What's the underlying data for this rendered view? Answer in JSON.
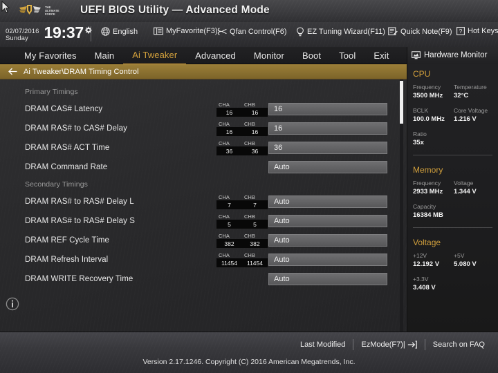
{
  "header": {
    "title": "UEFI BIOS Utility — Advanced Mode",
    "logo_line1": "THE",
    "logo_line2": "ULTIMATE",
    "logo_line3": "FORCE"
  },
  "toolbar": {
    "date": "02/07/2016",
    "day": "Sunday",
    "time": "19:37",
    "items": [
      {
        "label": "English",
        "icon": "globe-icon"
      },
      {
        "label": "MyFavorite(F3)",
        "icon": "book-icon"
      },
      {
        "label": "Qfan Control(F6)",
        "icon": "fan-icon"
      },
      {
        "label": "EZ Tuning Wizard(F11)",
        "icon": "bulb-icon"
      },
      {
        "label": "Quick Note(F9)",
        "icon": "note-icon"
      },
      {
        "label": "Hot Keys",
        "icon": "question-box-icon"
      }
    ]
  },
  "tabs": [
    {
      "label": "My Favorites",
      "active": false
    },
    {
      "label": "Main",
      "active": false
    },
    {
      "label": "Ai Tweaker",
      "active": true
    },
    {
      "label": "Advanced",
      "active": false
    },
    {
      "label": "Monitor",
      "active": false
    },
    {
      "label": "Boot",
      "active": false
    },
    {
      "label": "Tool",
      "active": false
    },
    {
      "label": "Exit",
      "active": false
    }
  ],
  "breadcrumb": {
    "path": "Ai Tweaker\\DRAM Timing Control"
  },
  "settings": [
    {
      "type": "section",
      "label": "Primary Timings"
    },
    {
      "type": "item",
      "label": "DRAM CAS# Latency",
      "cha": "16",
      "chb": "16",
      "value": "16"
    },
    {
      "type": "item",
      "label": "DRAM RAS# to CAS# Delay",
      "cha": "16",
      "chb": "16",
      "value": "16"
    },
    {
      "type": "item",
      "label": "DRAM RAS# ACT Time",
      "cha": "36",
      "chb": "36",
      "value": "36"
    },
    {
      "type": "item",
      "label": "DRAM Command Rate",
      "cha": "",
      "chb": "",
      "value": "Auto"
    },
    {
      "type": "section",
      "label": "Secondary Timings"
    },
    {
      "type": "item",
      "label": "DRAM RAS# to RAS# Delay L",
      "cha": "7",
      "chb": "7",
      "value": "Auto"
    },
    {
      "type": "item",
      "label": "DRAM RAS# to RAS# Delay S",
      "cha": "5",
      "chb": "5",
      "value": "Auto"
    },
    {
      "type": "item",
      "label": "DRAM REF Cycle Time",
      "cha": "382",
      "chb": "382",
      "value": "Auto"
    },
    {
      "type": "item",
      "label": "DRAM Refresh Interval",
      "cha": "11454",
      "chb": "11454",
      "value": "Auto"
    },
    {
      "type": "item",
      "label": "DRAM WRITE Recovery Time",
      "cha": "",
      "chb": "",
      "value": "Auto"
    }
  ],
  "channel_labels": {
    "cha": "CHA",
    "chb": "CHB"
  },
  "hardware_monitor": {
    "title": "Hardware Monitor",
    "sections": [
      {
        "title": "CPU",
        "fields": [
          {
            "key": "Frequency",
            "value": "3500 MHz",
            "full": false
          },
          {
            "key": "Temperature",
            "value": "32°C",
            "full": false
          },
          {
            "key": "BCLK",
            "value": "100.0 MHz",
            "full": false
          },
          {
            "key": "Core Voltage",
            "value": "1.216 V",
            "full": false
          },
          {
            "key": "Ratio",
            "value": "35x",
            "full": true
          }
        ]
      },
      {
        "title": "Memory",
        "fields": [
          {
            "key": "Frequency",
            "value": "2933 MHz",
            "full": false
          },
          {
            "key": "Voltage",
            "value": "1.344 V",
            "full": false
          },
          {
            "key": "Capacity",
            "value": "16384 MB",
            "full": true
          }
        ]
      },
      {
        "title": "Voltage",
        "fields": [
          {
            "key": "+12V",
            "value": "12.192 V",
            "full": false
          },
          {
            "key": "+5V",
            "value": "5.080 V",
            "full": false
          },
          {
            "key": "+3.3V",
            "value": "3.408 V",
            "full": true
          }
        ]
      }
    ]
  },
  "footer": {
    "buttons": [
      {
        "label": "Last Modified",
        "icon": ""
      },
      {
        "label": "EzMode(F7)|",
        "icon": "arrow-right-box-icon"
      },
      {
        "label": "Search on FAQ",
        "icon": ""
      }
    ],
    "version": "Version 2.17.1246. Copyright (C) 2016 American Megatrends, Inc."
  },
  "colors": {
    "accent": "#d2a03c",
    "breadcrumb": "#8a7030"
  }
}
